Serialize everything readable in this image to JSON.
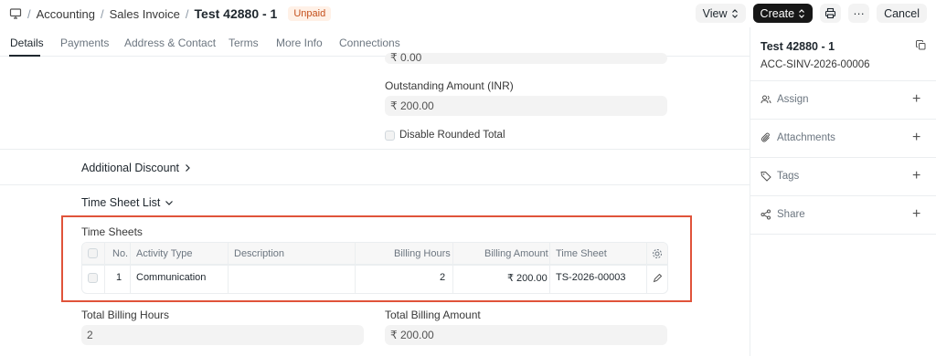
{
  "breadcrumb": {
    "module": "Accounting",
    "doctype": "Sales Invoice",
    "title": "Test 42880 - 1",
    "status": "Unpaid"
  },
  "toolbar": {
    "view": "View",
    "create": "Create",
    "cancel": "Cancel",
    "more": "···"
  },
  "tabs": [
    "Details",
    "Payments",
    "Address & Contact",
    "Terms",
    "More Info",
    "Connections"
  ],
  "form": {
    "partial_value": "₹ 0.00",
    "outstanding_label": "Outstanding Amount (INR)",
    "outstanding_value": "₹ 200.00",
    "disable_rounded_label": "Disable Rounded Total",
    "additional_discount": "Additional Discount",
    "time_sheet_list": "Time Sheet List",
    "time_sheets_label": "Time Sheets",
    "total_billing_hours_label": "Total Billing Hours",
    "total_billing_hours_value": "2",
    "total_billing_amount_label": "Total Billing Amount",
    "total_billing_amount_value": "₹ 200.00"
  },
  "table": {
    "columns": [
      "No.",
      "Activity Type",
      "Description",
      "Billing Hours",
      "Billing Amount",
      "Time Sheet"
    ],
    "rows": [
      {
        "no": "1",
        "activity_type": "Communication",
        "description": "",
        "billing_hours": "2",
        "billing_amount": "₹ 200.00",
        "time_sheet": "TS-2026-00003"
      }
    ]
  },
  "sidebar": {
    "title": "Test 42880 - 1",
    "name": "ACC-SINV-2026-00006",
    "items": [
      "Assign",
      "Attachments",
      "Tags",
      "Share"
    ]
  }
}
